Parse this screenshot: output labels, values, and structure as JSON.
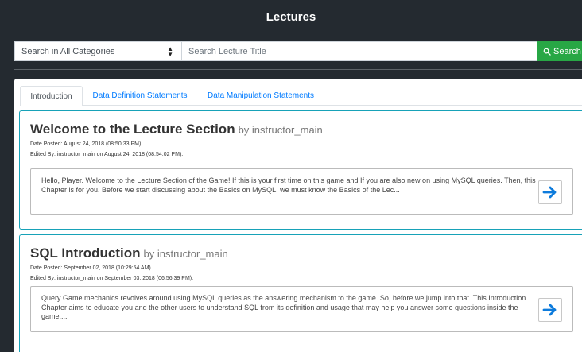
{
  "header": {
    "title": "Lectures"
  },
  "search": {
    "category_value": "Search in All Categories",
    "title_placeholder": "Search Lecture Title",
    "button_label": "Search"
  },
  "tabs": [
    {
      "label": "Introduction",
      "active": true
    },
    {
      "label": "Data Definition Statements",
      "active": false
    },
    {
      "label": "Data Manipulation Statements",
      "active": false
    }
  ],
  "lectures": [
    {
      "title": "Welcome to the Lecture Section",
      "author": "by instructor_main",
      "date_posted": "Date Posted: August 24, 2018 (08:50:33 PM).",
      "edited_by": "Edited By: instructor_main on August 24, 2018 (08:54:02 PM).",
      "excerpt": "Hello, Player. Welcome to the Lecture Section of the Game! If this is your first time on this game and If you are also new on using MySQL queries. Then, this Chapter is for you. Before we start discussing about the Basics on MySQL, we must know the Basics of the Lec..."
    },
    {
      "title": "SQL Introduction",
      "author": "by instructor_main",
      "date_posted": "Date Posted: September 02, 2018 (10:29:54 AM).",
      "edited_by": "Edited By: instructor_main on September 03, 2018 (06:56:39 PM).",
      "excerpt": "Query Game mechanics revolves around using MySQL queries as the answering mechanism to the game. So, before we jump into that. This Introduction Chapter aims to educate you and the other users to understand SQL from its definition and usage that may help you answer some questions inside the game...."
    }
  ],
  "colors": {
    "accent": "#007bff",
    "card_border": "#17a2b8",
    "search_button": "#28a745",
    "background": "#242a30"
  },
  "icons": {
    "search": "search-icon",
    "open_lecture": "arrow-right-icon",
    "select": "select-arrows-icon"
  }
}
